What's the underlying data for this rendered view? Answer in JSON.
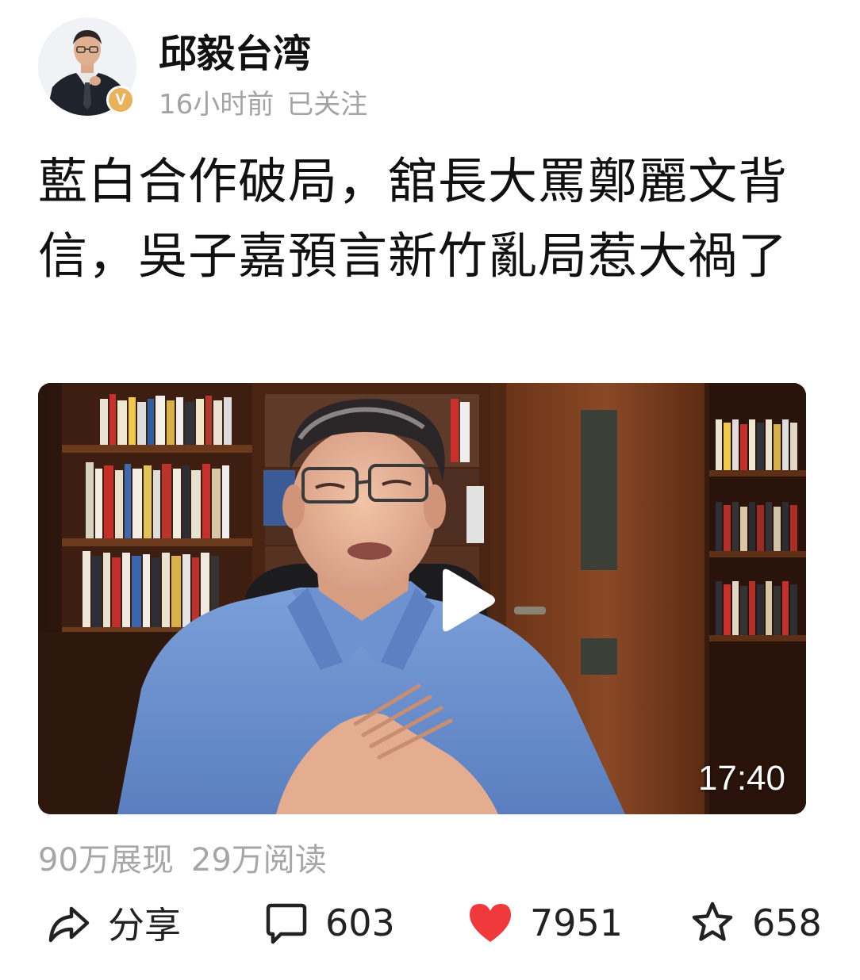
{
  "author": {
    "name": "邱毅台湾",
    "verified_badge": "V",
    "time_ago": "16小时前",
    "follow_status": "已关注"
  },
  "post": {
    "title": "藍白合作破局，舘長大罵鄭麗文背信，吳子嘉預言新竹亂局惹大禍了"
  },
  "video": {
    "duration": "17:40",
    "play_icon": "play-icon"
  },
  "stats": {
    "impressions": "90万展现",
    "reads": "29万阅读"
  },
  "actions": {
    "share_label": "分享",
    "comment_count": "603",
    "like_count": "7951",
    "favorite_count": "658"
  },
  "colors": {
    "like_red": "#f0393a",
    "muted_gray": "#a6a6a6",
    "badge_gold": "#eab05a"
  }
}
